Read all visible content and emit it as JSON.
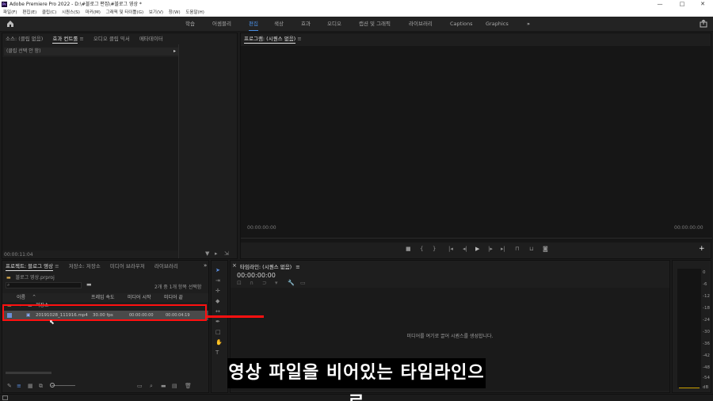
{
  "titlebar": {
    "app_badge": "Pr",
    "title": "Adobe Premiere Pro 2022 - D:\\#블로그 편집\\#블로그 영상 *",
    "minimize": "—",
    "maximize": "□",
    "close": "✕"
  },
  "menubar": [
    "파일(F)",
    "편집(E)",
    "클립(C)",
    "시퀀스(S)",
    "마커(M)",
    "그래픽 및 타이틀(G)",
    "보기(V)",
    "창(W)",
    "도움말(H)"
  ],
  "workspaces": [
    "학습",
    "어셈블리",
    "편집",
    "색상",
    "효과",
    "오디오",
    "캡션 및 그래픽",
    "라이브러리",
    "Captions",
    "Graphics"
  ],
  "workspaces_more": "»",
  "source_panel": {
    "tabs": [
      "소스: (클립 없음)",
      "효과 컨트롤",
      "오디오 클립 믹서",
      "메타데이터"
    ],
    "menu_glyph": "≡",
    "no_clip": "(클립 선택 안 함)",
    "timecode": "00:00:11:04"
  },
  "program_panel": {
    "title": "프로그램: (시퀀스 없음)",
    "menu_glyph": "≡",
    "tc_left": "00:00:00:00",
    "tc_right": "00:00:00:00",
    "add_glyph": "+"
  },
  "project_panel": {
    "tabs": [
      "프로젝트: 블로그 영상",
      "저장소: 저장소",
      "미디어 브라우저",
      "라이브러리"
    ],
    "more": "»",
    "project_file": "블로그 영상.prproj",
    "item_count": "2개 중 1개 항목 선택함",
    "columns": [
      "이름",
      "프레임 속도",
      "미디어 시작",
      "미디어 끝"
    ],
    "folder_row": {
      "name": "저장소"
    },
    "clip_row": {
      "name": "20191028_111916.mp4",
      "fps": "30.00 fps",
      "start": "00:00:00:00",
      "end": "00:00:04:19"
    }
  },
  "timeline_panel": {
    "title": "타임라인: (시퀀스 없음)",
    "menu_glyph": "≡",
    "close_glyph": "×",
    "timecode": "00:00:00:00",
    "drop_hint": "미디어를 여기로 끌어 시퀀스를 생성합니다."
  },
  "audio_meter": {
    "labels": [
      "0",
      "-6",
      "-12",
      "-18",
      "-24",
      "-30",
      "-36",
      "-42",
      "-48",
      "-54",
      "dB"
    ]
  },
  "caption": "영상 파일을 비어있는 타임라인으로",
  "colors": {
    "accent": "#4a8fe4",
    "annotation": "#ff1010",
    "folder": "#d6a74a"
  }
}
